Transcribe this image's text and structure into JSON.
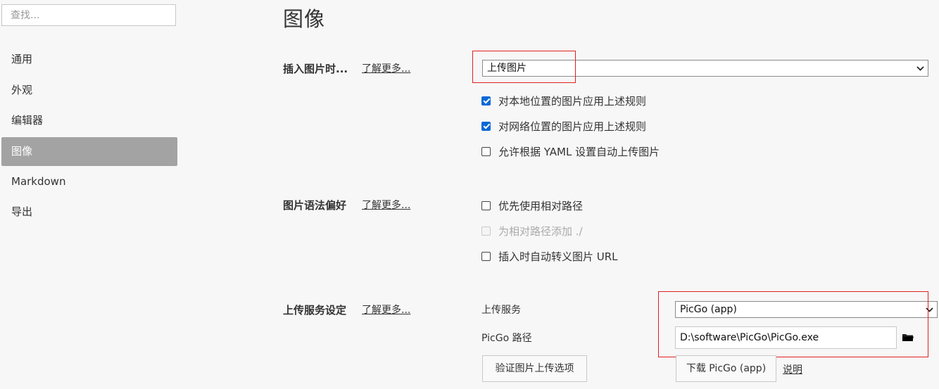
{
  "sidebar": {
    "search_placeholder": "查找...",
    "items": [
      {
        "label": "通用"
      },
      {
        "label": "外观"
      },
      {
        "label": "编辑器"
      },
      {
        "label": "图像",
        "active": true
      },
      {
        "label": "Markdown"
      },
      {
        "label": "导出"
      }
    ]
  },
  "page": {
    "title": "图像"
  },
  "insert_image": {
    "label": "插入图片时...",
    "more": "了解更多...",
    "select_value": "上传图片",
    "checkboxes": [
      {
        "label": "对本地位置的图片应用上述规则",
        "checked": true
      },
      {
        "label": "对网络位置的图片应用上述规则",
        "checked": true
      },
      {
        "label": "允许根据 YAML 设置自动上传图片",
        "checked": false
      }
    ]
  },
  "image_syntax": {
    "label": "图片语法偏好",
    "more": "了解更多...",
    "checkboxes": [
      {
        "label": "优先使用相对路径",
        "checked": false
      },
      {
        "label": "为相对路径添加 ./",
        "checked": false,
        "disabled": true
      },
      {
        "label": "插入时自动转义图片 URL",
        "checked": false
      }
    ]
  },
  "upload_service": {
    "label": "上传服务设定",
    "more": "了解更多...",
    "service_label": "上传服务",
    "service_value": "PicGo (app)",
    "path_label": "PicGo 路径",
    "path_value": "D:\\software\\PicGo\\PicGo.exe",
    "verify_button": "验证图片上传选项",
    "download_button": "下载 PicGo (app)",
    "explain_link": "说明"
  },
  "colors": {
    "accent": "#0b68d7",
    "highlight_box": "#e02020",
    "active_nav": "#a3a3a3"
  },
  "icons": {
    "select_arrow": "chevron-down-icon",
    "folder": "folder-icon"
  }
}
